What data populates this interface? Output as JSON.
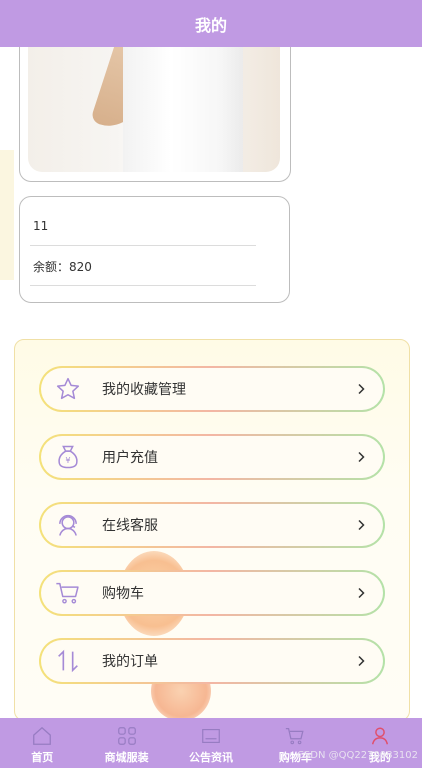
{
  "header": {
    "title": "我的"
  },
  "profile": {
    "username": "11",
    "balance_label": "余额：",
    "balance_value": "820"
  },
  "menu": [
    {
      "label": "我的收藏管理",
      "icon": "star-icon"
    },
    {
      "label": "用户充值",
      "icon": "money-bag-icon"
    },
    {
      "label": "在线客服",
      "icon": "customer-service-icon"
    },
    {
      "label": "购物车",
      "icon": "cart-icon"
    },
    {
      "label": "我的订单",
      "icon": "sort-arrows-icon"
    }
  ],
  "tabbar": [
    {
      "label": "首页",
      "icon": "home-icon"
    },
    {
      "label": "商城服装",
      "icon": "grid-icon"
    },
    {
      "label": "公告资讯",
      "icon": "news-icon"
    },
    {
      "label": "购物车",
      "icon": "cart-icon"
    },
    {
      "label": "我的",
      "icon": "user-icon",
      "active": true
    }
  ],
  "watermark": "CSDN @QQ2270983102",
  "colors": {
    "primary": "#c09ae3",
    "menu_icon": "#a58ad6",
    "active_tab": "#e04f6c"
  }
}
